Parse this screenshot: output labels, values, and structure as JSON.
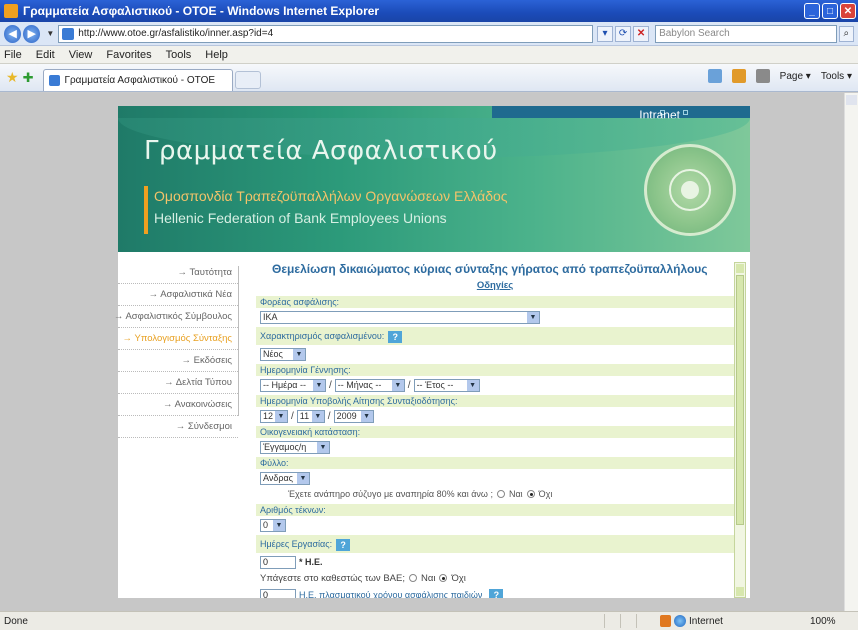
{
  "window": {
    "title": "Γραμματεία Ασφαλιστικού - ΟΤΟΕ - Windows Internet Explorer"
  },
  "addressbar": {
    "url": "http://www.otoe.gr/asfalistiko/inner.asp?id=4",
    "search_placeholder": "Babylon Search"
  },
  "menubar": {
    "items": [
      "File",
      "Edit",
      "View",
      "Favorites",
      "Tools",
      "Help"
    ]
  },
  "tabs": {
    "active_title": "Γραμματεία Ασφαλιστικού - ΟΤΟΕ"
  },
  "commandbar": {
    "page": "Page",
    "tools": "Tools"
  },
  "banner": {
    "intranet": "Intranet",
    "title": "Γραμματεία Ασφαλιστικού",
    "subtitle_gr": "Ομοσπονδία Τραπεζοϋπαλλήλων Οργανώσεων Ελλάδος",
    "subtitle_en": "Hellenic Federation of Bank Employees Unions"
  },
  "nav": {
    "items": [
      {
        "label": "→ Ταυτότητα",
        "active": false
      },
      {
        "label": "→ Ασφαλιστικά Νέα",
        "active": false
      },
      {
        "label": "→ Ασφαλιστικός Σύμβουλος",
        "active": false
      },
      {
        "label": "→ Υπολογισμός Σύνταξης",
        "active": true
      },
      {
        "label": "→ Εκδόσεις",
        "active": false
      },
      {
        "label": "→ Δελτία Τύπου",
        "active": false
      },
      {
        "label": "→ Ανακοινώσεις",
        "active": false
      },
      {
        "label": "→ Σύνδεσμοι",
        "active": false
      }
    ]
  },
  "form": {
    "title": "Θεμελίωση δικαιώματος κύριας σύνταξης γήρατος από τραπεζοϋπαλλήλους",
    "instructions": "Οδηγίες",
    "fields": {
      "insurer_label": "Φορέας ασφάλισης:",
      "insurer_value": "ΙΚΑ",
      "insured_type_label": "Χαρακτηρισμός ασφαλισμένου:",
      "insured_type_value": "Νέος",
      "birthdate_label": "Ημερομηνία Γέννησης:",
      "birth_day": "-- Ημέρα --",
      "birth_month": "-- Μήνας --",
      "birth_year": "-- Έτος --",
      "application_date_label": "Ημερομηνία Υποβολής Αίτησης Συνταξιοδότησης:",
      "app_day": "12",
      "app_month": "11",
      "app_year": "2009",
      "marital_label": "Οικογενειακή κατάσταση:",
      "marital_value": "Έγγαμος/η",
      "sex_label": "Φύλλο:",
      "sex_value": "Ανδρας",
      "disabled_spouse_question": "Έχετε ανάπηρο σύζυγο με αναπηρία 80% και άνω ;",
      "yes": "Ναι",
      "no": "Όχι",
      "children_label": "Αριθμός τέκνων:",
      "children_value": "0",
      "work_days_label": "Ημέρες Εργασίας:",
      "work_days_value": "0",
      "work_days_unit": "* Η.Ε.",
      "bae_question": "Υπάγεστε στο καθεστώς των ΒΑΕ;",
      "extra_days_value": "0",
      "extra_days_text": "Η.Ε. πλασματικού χρόνου ασφάλισης παιδιών"
    }
  },
  "statusbar": {
    "status": "Done",
    "zone": "Internet",
    "zoom": "100%"
  },
  "colors": {
    "accent_blue": "#2d6b9f",
    "label_bg": "#e9f3cf",
    "active_nav": "#e8a020"
  }
}
